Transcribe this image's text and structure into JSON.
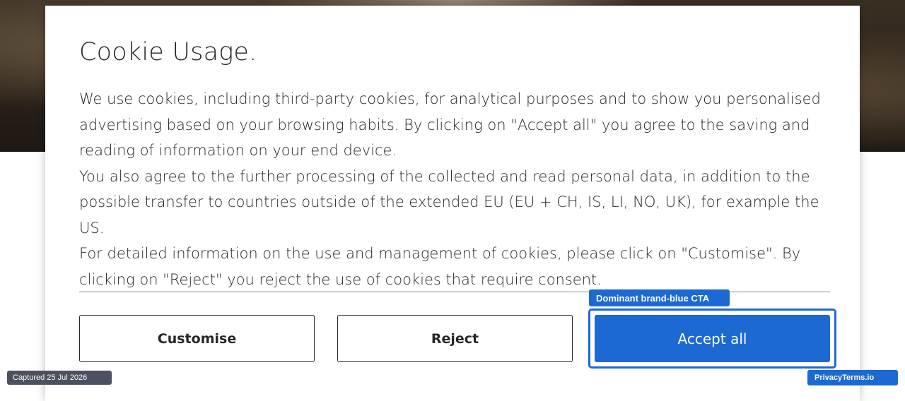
{
  "modal": {
    "title": "Cookie Usage.",
    "paragraphs": [
      "We use cookies, including third-party cookies, for analytical purposes and to show you personalised advertising based on your browsing habits. By clicking on \"Accept all\" you agree to the saving and reading of information on your end device.",
      "You also agree to the further processing of the collected and read personal data, in addition to the possible transfer to countries outside of the extended EU (EU + CH, IS, LI, NO, UK), for example the US.",
      "For detailed information on the use and management of cookies, please click on \"Customise\". By clicking on \"Reject\" you reject the use of cookies that require consent."
    ],
    "buttons": {
      "customise": "Customise",
      "reject": "Reject",
      "accept_all": "Accept all"
    }
  },
  "annotation": {
    "label": "Dominant brand-blue CTA"
  },
  "overlay": {
    "captured": "Captured 25 Jul 2026",
    "watermark": "PrivacyTerms.io"
  },
  "colors": {
    "brand_blue": "#1c69d4",
    "text": "#262626"
  }
}
